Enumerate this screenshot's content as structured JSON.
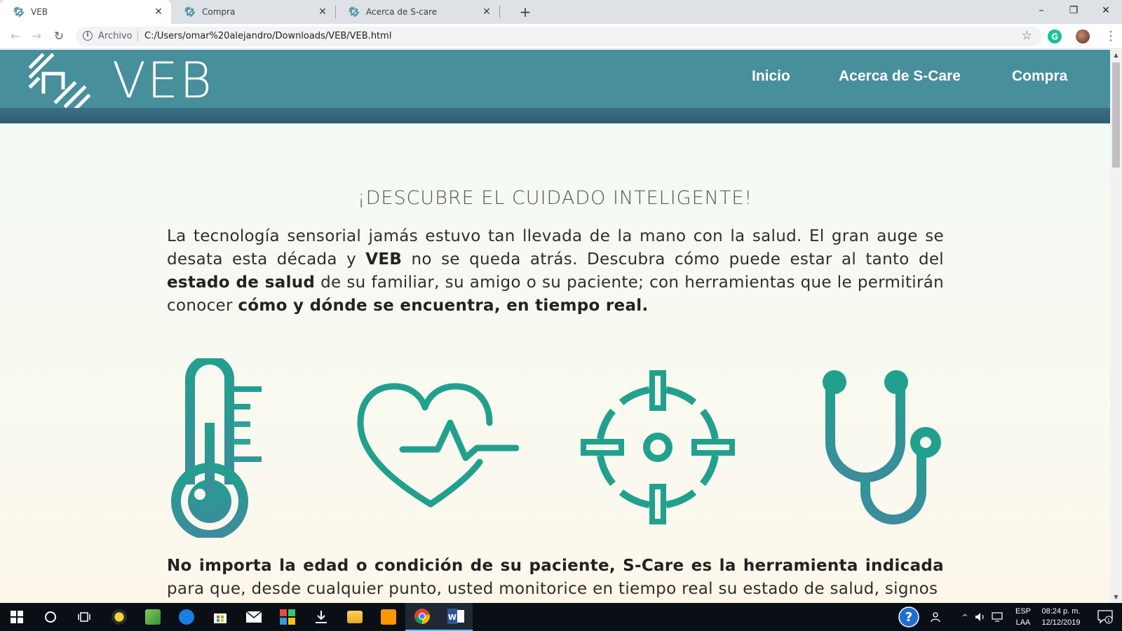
{
  "browser": {
    "tabs": [
      {
        "label": "VEB",
        "active": true
      },
      {
        "label": "Compra",
        "active": false
      },
      {
        "label": "Acerca de S-care",
        "active": false
      }
    ],
    "new_tab_symbol": "+",
    "window_controls": {
      "minimize": "–",
      "restore": "❐",
      "close": "✕"
    },
    "address_scheme": "Archivo",
    "address_url": "C:/Users/omar%20alejandro/Downloads/VEB/VEB.html"
  },
  "site": {
    "logo_text": "VEB",
    "nav": [
      "Inicio",
      "Acerca de S-Care",
      "Compra"
    ],
    "headline": "¡DESCUBRE EL CUIDADO INTELIGENTE!",
    "intro": {
      "p1": "La tecnología sensorial jamás estuvo tan llevada de la mano con la salud. El gran auge se desata esta década y ",
      "b1": "VEB",
      "p2": " no se queda atrás. Descubra cómo puede estar al tanto del ",
      "b2": "estado de salud",
      "p3": " de su familiar, su amigo o su paciente; con herramientas que le permitirán conocer ",
      "b3": "cómo y dónde se encuentra, en tiempo real."
    },
    "icons": [
      "thermometer-icon",
      "heart-pulse-icon",
      "location-target-icon",
      "stethoscope-icon"
    ],
    "second": {
      "b1": "No importa la edad o condición de su paciente, S-Care es la herramienta indicada",
      "p1": " para que, desde cualquier punto, usted monitorice en tiempo real su estado de salud, signos"
    }
  },
  "colors": {
    "header": "#468f9b",
    "icon_teal": "#22a08e",
    "icon_blue": "#3c8c9c"
  },
  "taskbar": {
    "language": "ESP",
    "layout": "LAA",
    "time": "08:24 p. m.",
    "date": "12/12/2019",
    "notifications": "1"
  }
}
